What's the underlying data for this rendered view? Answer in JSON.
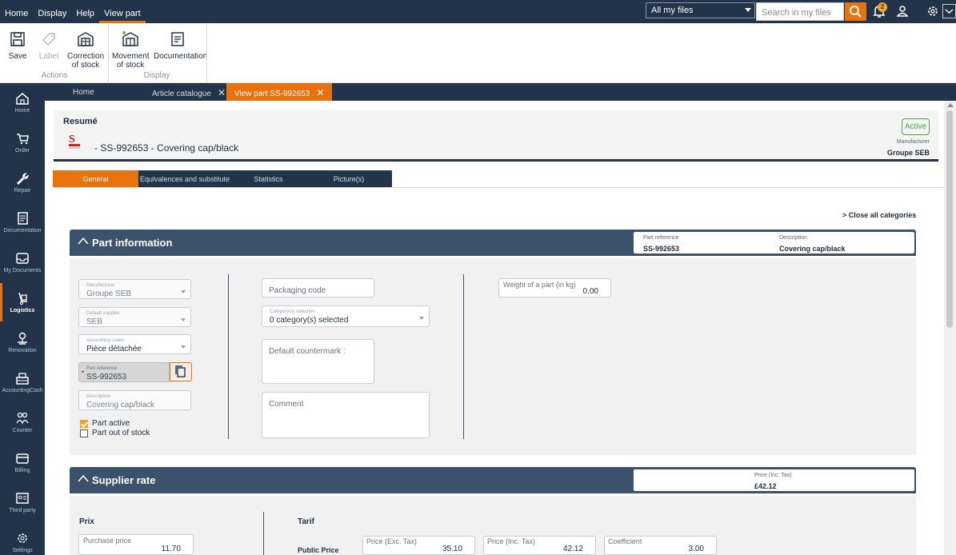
{
  "topbar": {
    "menu": [
      "Home",
      "Display",
      "Help",
      "View part"
    ],
    "files_select": "All my files",
    "search_placeholder": "Search in my files",
    "notif_count": "2"
  },
  "ribbon": {
    "buttons": [
      {
        "label": "Save"
      },
      {
        "label": "Label"
      },
      {
        "label": "Correction of stock"
      },
      {
        "label": "Movement of stock"
      },
      {
        "label": "Documentation"
      }
    ],
    "groups": [
      "Actions",
      "Display"
    ]
  },
  "sidenav": [
    "Home",
    "Order",
    "Repair",
    "Documentation",
    "My Documents",
    "Logistics",
    "Renovation",
    "AccountingCash",
    "Counter",
    "Billing",
    "Third party",
    "Settings"
  ],
  "doctabs": [
    "Home",
    "Article catalogue",
    "View part SS-992653"
  ],
  "resume": {
    "title": "Resumé",
    "part": "- SS-992653 - Covering cap/black",
    "status": "Active",
    "manufacturer_label": "Manufacturer",
    "manufacturer": "Groupe SEB"
  },
  "tabs": [
    "General",
    "Equivalences and substitute",
    "Statistics",
    "Picture(s)"
  ],
  "close_all": "> Close all categories",
  "part_info": {
    "title": "Part information",
    "ref_label": "Part reference",
    "ref_value": "SS-992653",
    "desc_label": "Description",
    "desc_value": "Covering cap/black",
    "manufacturer_label": "Manufacturer",
    "manufacturer_value": "Groupe SEB",
    "supplier_label": "Default supplier",
    "supplier_value": "SEB",
    "accounting_label": "Accounting codes",
    "accounting_value": "Pièce détachée",
    "partref_label": "Part reference",
    "partref_value": "SS-992653",
    "description_label": "Description",
    "description_value": "Covering cap/black",
    "part_active": "Part active",
    "out_of_stock": "Part out of stock",
    "packaging": "Packaging code",
    "category_label": "Category(s) selection",
    "category_value": "0 category(s) selected",
    "countermark": "Default countermark :",
    "comment": "Comment",
    "weight_label": "Weight of a part (in kg)",
    "weight_value": "0.00"
  },
  "supplier_rate": {
    "title": "Supplier rate",
    "price_label": "Price (Inc. Tax)",
    "price_value": "£42.12",
    "prix": "Prix",
    "purchase_label": "Purchase price",
    "purchase_value": "11.70",
    "tarif": "Tarif",
    "public_price": "Public Price",
    "exc_label": "Price (Exc. Tax)",
    "exc_value": "35.10",
    "inc_label": "Price (Inc. Tax)",
    "inc_value": "42.12",
    "coef_label": "Coefficient",
    "coef_value": "3.00"
  },
  "colors": {
    "navy": "#23344a",
    "accent": "#e8730e",
    "section": "#3c526c",
    "active": "#4caa3c"
  }
}
